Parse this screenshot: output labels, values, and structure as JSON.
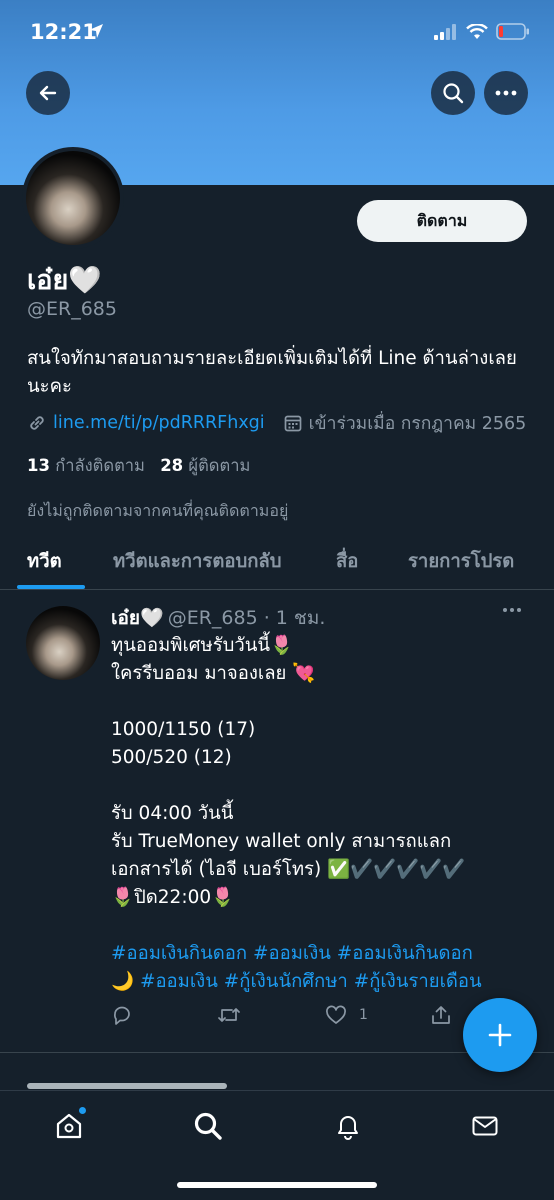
{
  "status_bar": {
    "time": "12:21"
  },
  "profile": {
    "display_name": "เอ๋ย🤍",
    "handle": "@ER_685",
    "follow_button_label": "ติดตาม",
    "bio": "สนใจทักมาสอบถามรายละเอียดเพิ่มเติมได้ที่ Line ด้านล่างเลยนะคะ",
    "link": "line.me/ti/p/pdRRRFhxgi",
    "joined": "เข้าร่วมเมื่อ กรกฎาคม 2565",
    "following_count": "13",
    "following_label": "กำลังติดตาม",
    "followers_count": "28",
    "followers_label": "ผู้ติดตาม",
    "not_followed_note": "ยังไม่ถูกติดตามจากคนที่คุณติดตามอยู่"
  },
  "tabs": [
    {
      "label": "ทวีต",
      "active": true
    },
    {
      "label": "ทวีตและการตอบกลับ",
      "active": false
    },
    {
      "label": "สื่อ",
      "active": false
    },
    {
      "label": "รายการโปรด",
      "active": false
    }
  ],
  "tweet": {
    "name": "เอ๋ย🤍",
    "handle_time": "@ER_685 · 1 ชม.",
    "lines": [
      "ทุนออมพิเศษรับวันนี้🌷",
      "ใครรีบออม มาจองเลย 💘",
      "",
      "1000/1150 (17)",
      "500/520 (12)",
      "",
      "รับ 04:00 วันนี้",
      "รับ TrueMoney wallet only สามารถแลก",
      "เอกสารได้ (ไอจี เบอร์โทร) ✅✔️✔️✔️✔️✔️",
      "🌷ปิด22:00🌷",
      ""
    ],
    "hashtag_line_1": "#ออมเงินกินดอก #ออมเงิน #ออมเงินกินดอก",
    "hashtag_line_2_emoji": "🌙",
    "hashtag_line_2": "#ออมเงิน #กู้เงินนักศึกษา #กู้เงินรายเดือน",
    "like_count": "1"
  },
  "icons": {
    "back": "back-arrow-icon",
    "search": "search-icon",
    "more": "more-icon",
    "link": "link-icon",
    "calendar": "calendar-icon",
    "reply": "reply-icon",
    "retweet": "retweet-icon",
    "like": "heart-icon",
    "share": "share-icon",
    "compose": "plus-icon",
    "nav_home": "home-icon",
    "nav_search": "search-icon",
    "nav_notifications": "bell-icon",
    "nav_messages": "mail-icon"
  },
  "colors": {
    "background": "#15202b",
    "accent": "#1d9bf0",
    "secondary_text": "#8b98a5",
    "banner": "#4e9be6"
  }
}
